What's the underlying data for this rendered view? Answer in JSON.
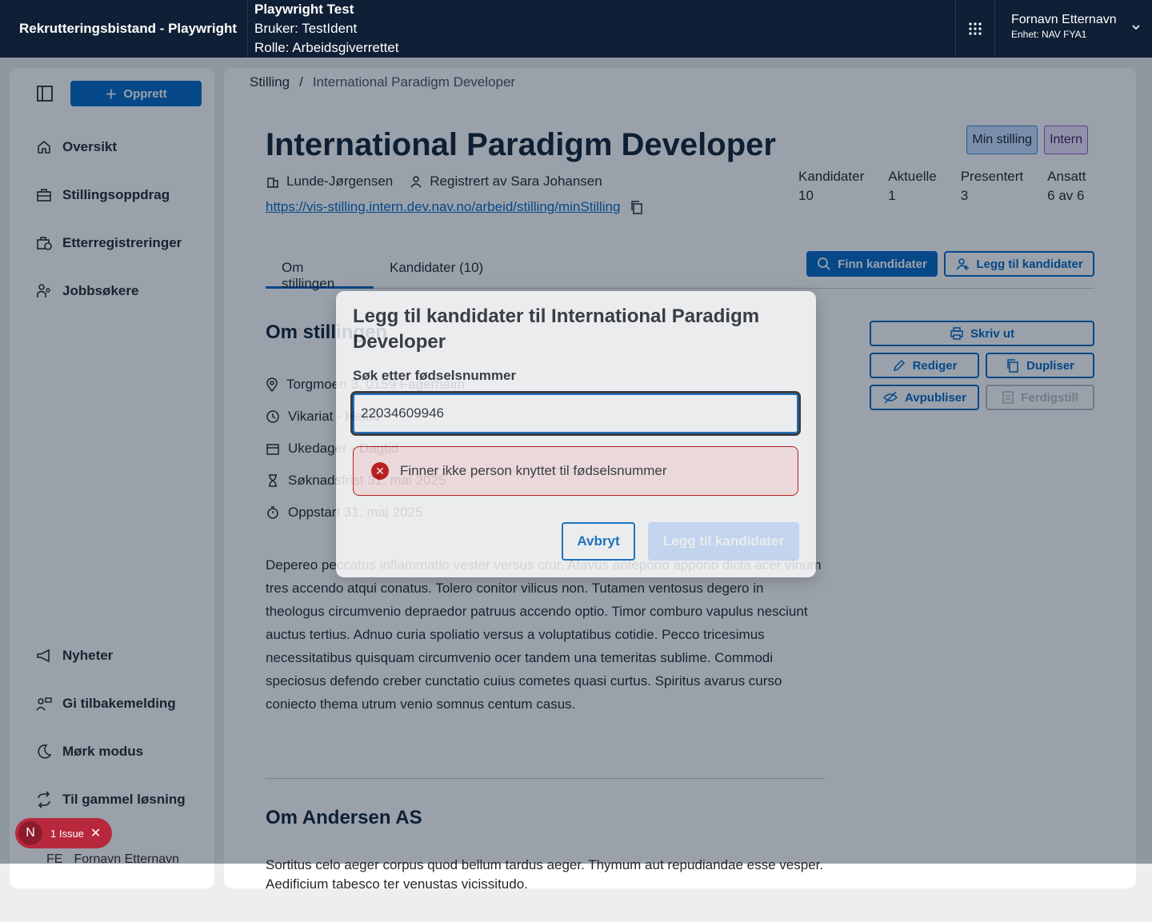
{
  "header": {
    "brand": "Rekrutteringsbistand - Playwright",
    "test_title": "Playwright Test",
    "test_user": "Bruker: TestIdent",
    "test_role": "Rolle: Arbeidsgiverrettet",
    "user_name": "Fornavn Etternavn",
    "user_unit": "Enhet: NAV FYA1"
  },
  "sidebar": {
    "create_label": "Opprett",
    "items": [
      {
        "label": "Oversikt",
        "icon": "house-icon"
      },
      {
        "label": "Stillingsoppdrag",
        "icon": "briefcase-icon"
      },
      {
        "label": "Etterregistreringer",
        "icon": "briefcase-clock-icon"
      },
      {
        "label": "Jobbsøkere",
        "icon": "people-icon"
      }
    ],
    "bottom_items": [
      {
        "label": "Nyheter",
        "icon": "megaphone-icon"
      },
      {
        "label": "Gi tilbakemelding",
        "icon": "feedback-icon"
      },
      {
        "label": "Mørk modus",
        "icon": "moon-icon"
      },
      {
        "label": "Til gammel løsning",
        "icon": "arrows-circle-icon"
      }
    ],
    "user_initials": "FE",
    "user_name": "Fornavn Etternavn"
  },
  "breadcrumb": {
    "root": "Stilling",
    "separator": "/",
    "current": "International Paradigm Developer"
  },
  "job": {
    "title": "International Paradigm Developer",
    "badge_min": "Min stilling",
    "badge_intern": "Intern",
    "employer": "Lunde-Jørgensen",
    "registered_by": "Registrert av Sara Johansen",
    "url": "https://vis-stilling.intern.dev.nav.no/arbeid/stilling/minStilling"
  },
  "stats": [
    {
      "label": "Kandidater",
      "value": "10"
    },
    {
      "label": "Aktuelle",
      "value": "1"
    },
    {
      "label": "Presentert",
      "value": "3"
    },
    {
      "label": "Ansatt",
      "value": "6 av 6"
    }
  ],
  "tabs": {
    "about": "Om stillingen",
    "candidates": "Kandidater (10)"
  },
  "actions": {
    "find": "Finn kandidater",
    "add": "Legg til kandidater",
    "print": "Skriv ut",
    "edit": "Rediger",
    "duplicate": "Dupliser",
    "unpublish": "Avpubliser",
    "finish": "Ferdigstill"
  },
  "about": {
    "heading": "Om stillingen",
    "facts": [
      {
        "icon": "location-icon",
        "label": "Torgmoen 3, 0159 Fagerheim"
      },
      {
        "icon": "clock-icon",
        "label": "Vikariat - Heltid"
      },
      {
        "icon": "calendar-icon",
        "label": "Ukedager - Dagtid"
      },
      {
        "icon": "hourglass-icon",
        "label": "Søknadsfrist 31. mai 2025"
      },
      {
        "icon": "stopwatch-icon",
        "label": "Oppstart 31. mai 2025"
      }
    ],
    "description": "Depereo peccatus inflammatio vester versus crur. Atavus antepono appono dicta acer vinum tres accendo atqui conatus. Tolero conitor vilicus non. Tutamen ventosus degero in theologus circumvenio depraedor patruus accendo optio. Timor comburo vapulus nesciunt auctus tertius. Adnuo curia spoliatio versus a voluptatibus cotidie. Pecco tricesimus necessitatibus quisquam circumvenio ocer tandem una temeritas sublime. Commodi speciosus defendo creber cunctatio cuius cometes quasi curtus. Spiritus avarus curso coniecto thema utrum venio somnus centum casus."
  },
  "employer_section": {
    "heading": "Om Andersen AS",
    "text": "Sortitus celo aeger corpus quod bellum tardus aeger. Thymum aut repudiandae esse vesper. Aedificium tabesco ter venustas vicissitudo."
  },
  "modal": {
    "title": "Legg til kandidater til International Paradigm Developer",
    "field_label": "Søk etter fødselsnummer",
    "field_value": "22034609946",
    "error": "Finner ikke person knyttet til fødselsnummer",
    "cancel": "Avbryt",
    "submit": "Legg til kandidater"
  },
  "devtools": {
    "initial": "N",
    "issues": "1 Issue"
  },
  "colors": {
    "primary": "#0067c5",
    "header_bg": "#0f1f35",
    "error": "#c30000"
  }
}
